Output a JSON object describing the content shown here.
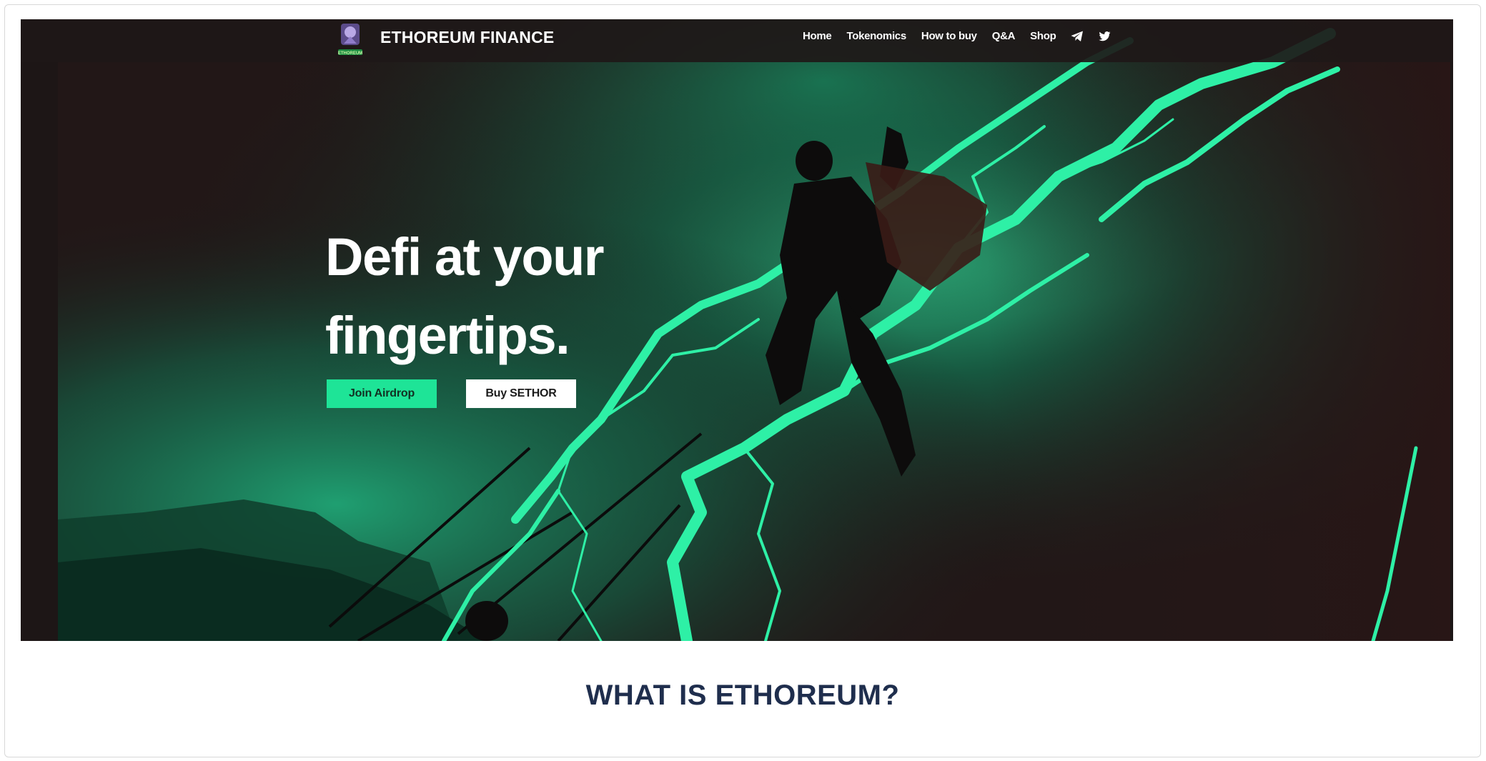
{
  "header": {
    "brand": "ETHOREUM FINANCE",
    "logo_caption": "ETHOREUM",
    "nav": [
      {
        "label": "Home"
      },
      {
        "label": "Tokenomics"
      },
      {
        "label": "How to buy"
      },
      {
        "label": "Q&A"
      },
      {
        "label": "Shop"
      }
    ],
    "social": [
      {
        "icon": "telegram-icon"
      },
      {
        "icon": "twitter-icon"
      }
    ]
  },
  "hero": {
    "headline_line1": "Defi at your",
    "headline_line2": "fingertips.",
    "primary_button": "Join Airdrop",
    "secondary_button": "Buy SETHOR",
    "accent_color": "#1ee497",
    "background_color": "#1d1616"
  },
  "about": {
    "title": "WHAT IS ETHOREUM?",
    "title_color": "#1f2e4d"
  }
}
